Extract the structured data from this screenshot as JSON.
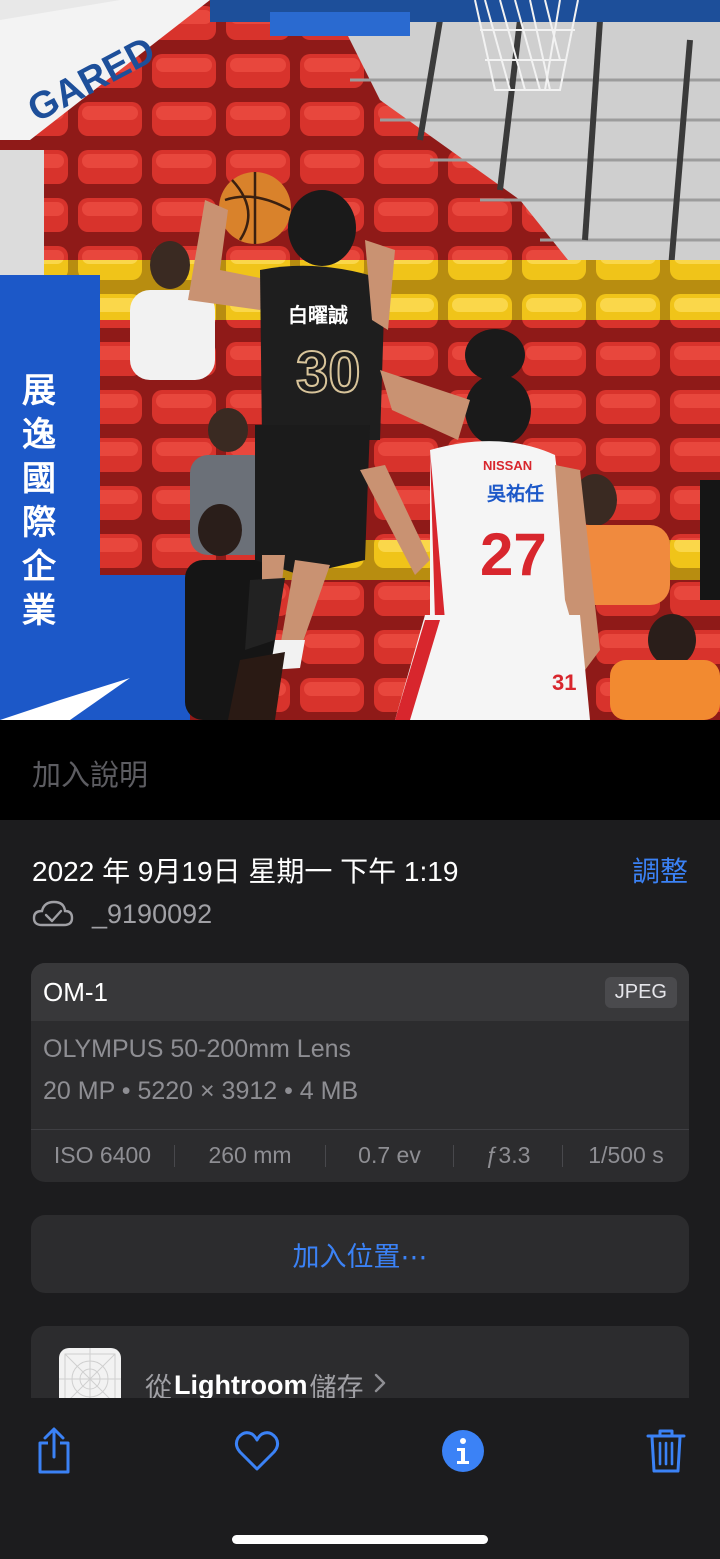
{
  "photo": {
    "description_icon": "photo-basketball-game",
    "arena_sign": "GARED",
    "banner_text": "展逸國際企業",
    "player_dark": {
      "name": "白曜誠",
      "number": "30"
    },
    "player_white": {
      "sponsor": "NISSAN",
      "name": "吳祐任",
      "number": "27"
    },
    "player_back_number": "31"
  },
  "caption": {
    "placeholder": "加入說明"
  },
  "info": {
    "date_time": "2022 年 9月19日 星期一 下午 1:19",
    "adjust_label": "調整",
    "filename": "_9190092",
    "camera_model": "OM-1",
    "format": "JPEG",
    "lens": "OLYMPUS 50-200mm Lens",
    "specs": "20 MP  •  5220 × 3912  •  4 MB",
    "exif": {
      "iso": "ISO 6400",
      "focal": "260 mm",
      "ev": "0.7 ev",
      "aperture": "ƒ3.3",
      "shutter": "1/500 s"
    },
    "location_label": "加入位置⋯",
    "lightroom": {
      "prefix": "從",
      "app": "Lightroom",
      "suffix": "儲存"
    }
  },
  "toolbar": {
    "share": "share-icon",
    "favorite": "heart-icon",
    "info": "info-icon",
    "delete": "trash-icon"
  },
  "colors": {
    "accent": "#3b82f6",
    "sheet": "#1c1c1e",
    "card": "#2c2c2e"
  }
}
